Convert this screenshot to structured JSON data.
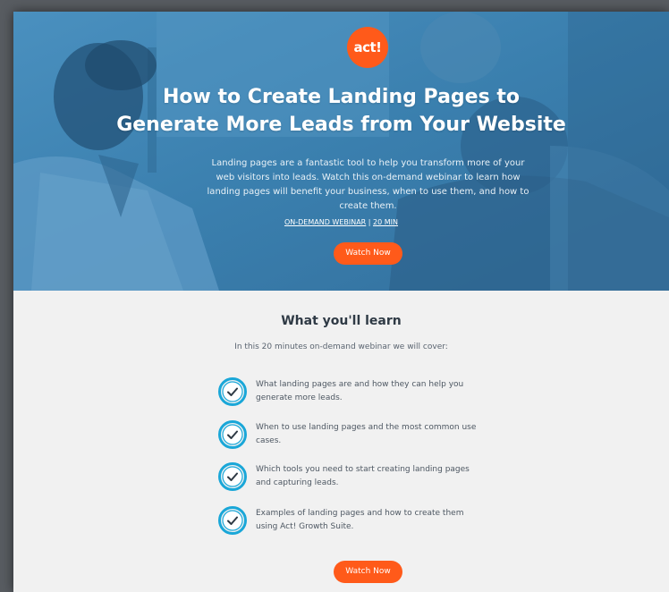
{
  "colors": {
    "brand_orange": "#ff5a1a",
    "hero_blue": "#3d85b5",
    "check_blue": "#1aa7d8",
    "section_bg": "#f1f1f1"
  },
  "hero": {
    "logo_text": "act!",
    "title_line1": "How to Create Landing Pages to",
    "title_line2": "Generate More Leads from Your Website",
    "description": "Landing pages are a fantastic tool to help you transform more of your web visitors into leads. Watch this on-demand webinar to learn how landing pages will benefit your business, when to use them, and how to create them.",
    "meta_type": "ON-DEMAND WEBINAR",
    "meta_separator": "|",
    "meta_length": "20 MIN",
    "cta_label": "Watch Now"
  },
  "learn": {
    "title": "What you'll learn",
    "intro": "In this 20 minutes on-demand webinar we will cover:",
    "items": [
      {
        "icon": "check-circle-icon",
        "text": "What landing pages are and how they can help you generate more leads."
      },
      {
        "icon": "check-circle-icon",
        "text": "When to use landing pages and the most common use cases."
      },
      {
        "icon": "check-circle-icon",
        "text": "Which tools you need to start creating landing pages and capturing leads."
      },
      {
        "icon": "check-circle-icon",
        "text": "Examples of landing pages and how to create them using Act! Growth Suite."
      }
    ],
    "cta_label": "Watch Now"
  }
}
